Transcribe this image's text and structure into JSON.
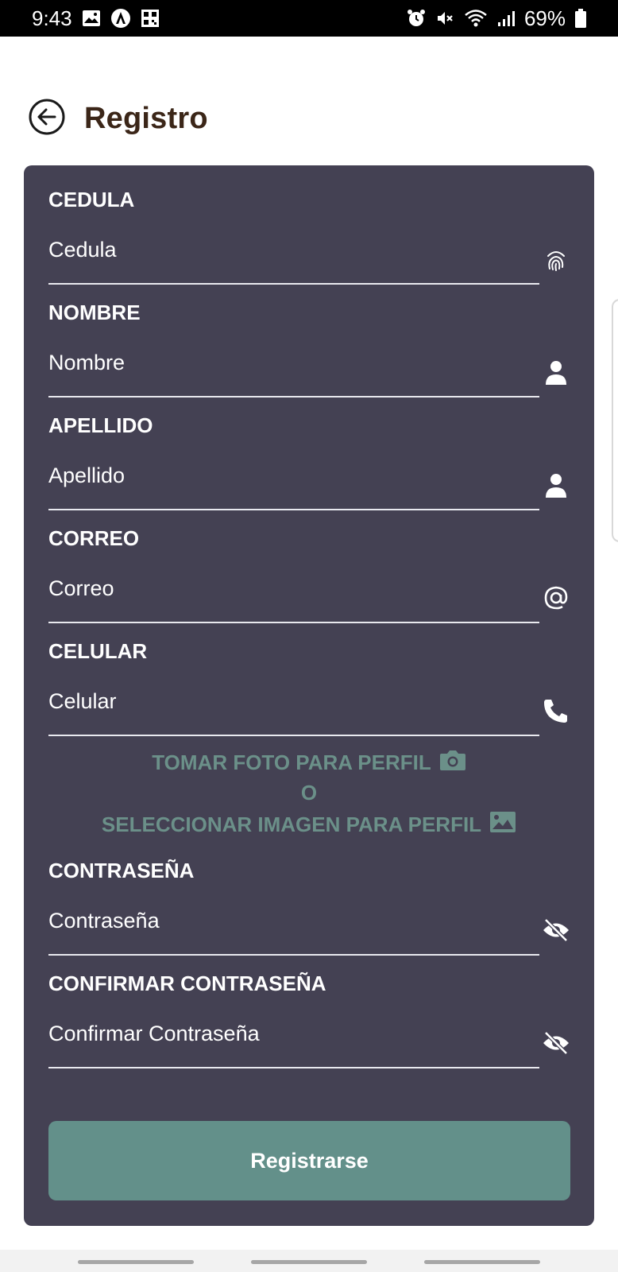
{
  "status_bar": {
    "time": "9:43",
    "battery": "69%",
    "left_icons": [
      "image-icon",
      "autopilot-icon",
      "qr-icon"
    ],
    "right_icons": [
      "alarm-icon",
      "mute-icon",
      "wifi-icon",
      "signal-icon",
      "battery-icon"
    ]
  },
  "header": {
    "title": "Registro",
    "back_icon": "arrow-left-circle-icon"
  },
  "form": {
    "cedula": {
      "label": "CEDULA",
      "placeholder": "Cedula",
      "icon": "fingerprint-icon"
    },
    "nombre": {
      "label": "NOMBRE",
      "placeholder": "Nombre",
      "icon": "user-icon"
    },
    "apellido": {
      "label": "APELLIDO",
      "placeholder": "Apellido",
      "icon": "user-icon"
    },
    "correo": {
      "label": "CORREO",
      "placeholder": "Correo",
      "icon": "at-icon"
    },
    "celular": {
      "label": "CELULAR",
      "placeholder": "Celular",
      "icon": "phone-icon"
    },
    "photo": {
      "take_photo": "TOMAR FOTO PARA PERFIL",
      "or": "O",
      "select_image": "SELECCIONAR IMAGEN PARA PERFIL"
    },
    "password": {
      "label": "CONTRASEÑA",
      "placeholder": "Contraseña",
      "icon": "eye-slash-icon"
    },
    "confirm_password": {
      "label": "CONFIRMAR CONTRASEÑA",
      "placeholder": "Confirmar Contraseña",
      "icon": "eye-slash-icon"
    },
    "submit_label": "Registrarse"
  },
  "colors": {
    "card_background": "#444153",
    "accent": "#63908a",
    "link_text": "#6b9089",
    "title_text": "#3b2618"
  }
}
